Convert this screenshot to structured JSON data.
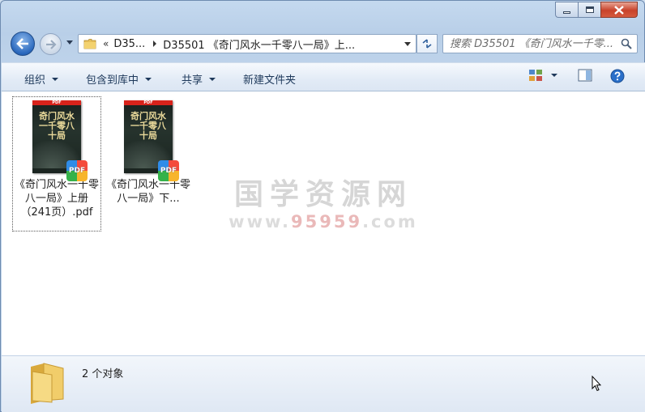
{
  "window": {
    "title": ""
  },
  "address": {
    "overflow": "«",
    "crumbs": [
      "D35...",
      "D35501 《奇门风水一千零八一局》上..."
    ]
  },
  "search": {
    "placeholder": "搜索 D35501 《奇门风水一千零..."
  },
  "toolbar": {
    "organize": "组织",
    "include_library": "包含到库中",
    "share": "共享",
    "new_folder": "新建文件夹"
  },
  "files": [
    {
      "name": "《奇门风水一千零八一局》上册（241页）.pdf",
      "selected": true,
      "cover_title": "奇门风水一千零八十局",
      "badge": "PDF",
      "strip": "PDF"
    },
    {
      "name": "《奇门风水一千零八一局》下...",
      "selected": false,
      "cover_title": "奇门风水一千零八十局",
      "badge": "PDF",
      "strip": "PDF"
    }
  ],
  "watermark": {
    "main": "国学资源网",
    "sub_prefix": "www.",
    "sub_highlight": "95959",
    "sub_suffix": ".com"
  },
  "details": {
    "count": "2 个对象"
  },
  "colors": {
    "accent": "#2a68bd",
    "close": "#c8422a",
    "watermark": "#d6d6d6"
  }
}
